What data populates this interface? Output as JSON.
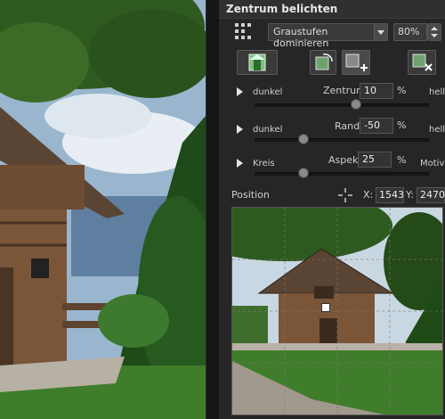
{
  "panel": {
    "title": "Zentrum belichten",
    "mode_select": "Graustufen dominieren",
    "zoom": "80%"
  },
  "sliders": [
    {
      "left": "dunkel",
      "name": "Zentrum",
      "value": "10",
      "unit": "%",
      "right": "hell",
      "fraction": 0.55
    },
    {
      "left": "dunkel",
      "name": "Rand",
      "value": "-50",
      "unit": "%",
      "right": "hell",
      "fraction": 0.25
    },
    {
      "left": "Kreis",
      "name": "Aspekt",
      "value": "25",
      "unit": "%",
      "right": "Motiv",
      "fraction": 0.28
    }
  ],
  "position": {
    "label": "Position",
    "x_label": "X:",
    "x_value": "1543",
    "y_label": "Y:",
    "y_value": "2470"
  },
  "icons": [
    "grid-icon",
    "preview-original-icon",
    "rotate-image-icon",
    "add-image-icon",
    "remove-image-icon",
    "crosshair-icon"
  ]
}
